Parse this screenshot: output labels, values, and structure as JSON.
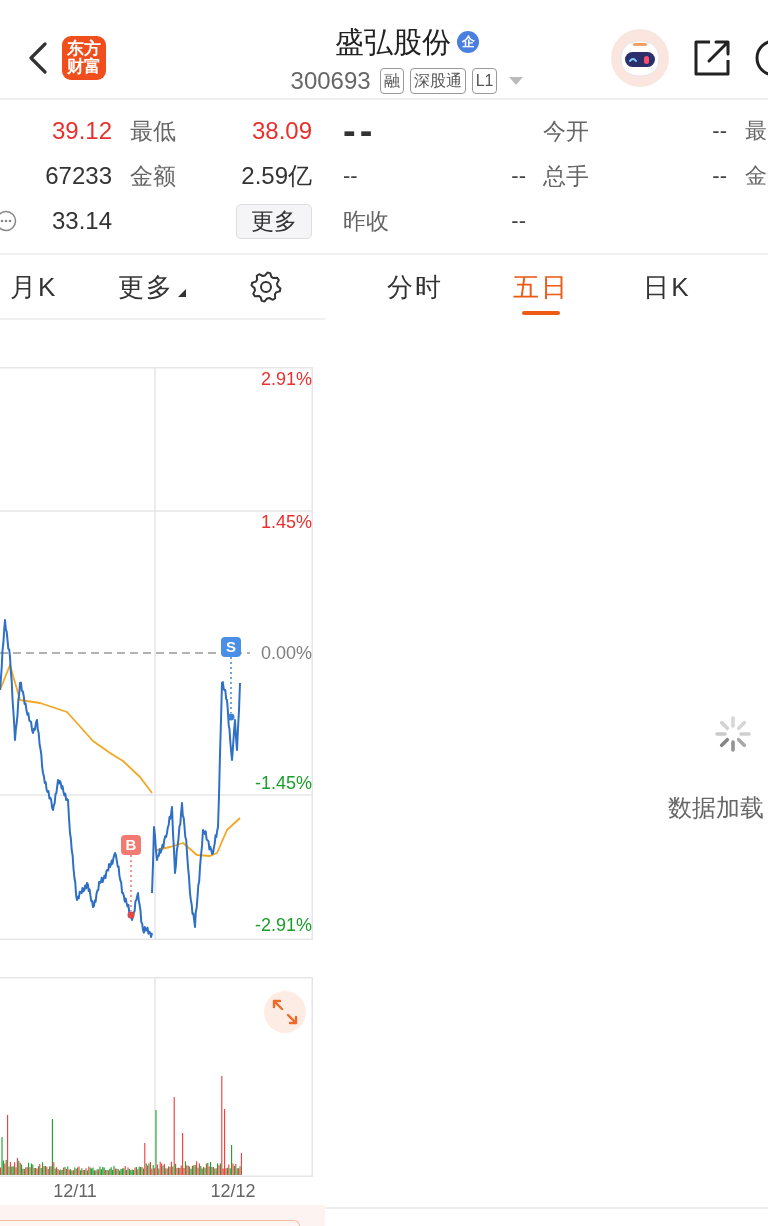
{
  "header": {
    "logo_text": "东方财富",
    "title": "盛弘股份",
    "title_badge": "企",
    "code": "300693",
    "tags": [
      "融",
      "深股通",
      "L1"
    ]
  },
  "left_quote": {
    "rows": [
      {
        "value": {
          "text": "39.12",
          "color": "#e8312f"
        },
        "label": "最低",
        "value2": {
          "text": "38.09",
          "color": "#e8312f"
        }
      },
      {
        "value": {
          "text": "67233",
          "color": "#333333"
        },
        "label": "金额",
        "value2": {
          "text": "2.59亿",
          "color": "#333333"
        }
      },
      {
        "value": {
          "text": "33.14",
          "color": "#333333"
        }
      }
    ],
    "more_button": "更多"
  },
  "left_tabs": [
    {
      "label": "月K",
      "selected": false,
      "kind": "tab"
    },
    {
      "label": "更多",
      "selected": false,
      "kind": "dropdown"
    }
  ],
  "price_chart": {
    "y_labels": [
      {
        "text": "2.91%",
        "color": "#e8312f"
      },
      {
        "text": "1.45%",
        "color": "#e8312f"
      },
      {
        "text": "0.00%",
        "color": "#808080"
      },
      {
        "text": "-1.45%",
        "color": "#1a9e2a"
      },
      {
        "text": "-2.91%",
        "color": "#1a9e2a"
      }
    ],
    "markers": [
      {
        "label": "B",
        "kind": "buy"
      },
      {
        "label": "S",
        "kind": "sell"
      }
    ]
  },
  "volume_chart": {
    "x_labels": [
      "12/11",
      "12/12"
    ]
  },
  "right_quote": {
    "price": "--",
    "change": "--",
    "change_pct": "--",
    "prev_close_label": "昨收",
    "prev_close": "--",
    "fields": [
      {
        "label": "今开",
        "value": "--",
        "next_label": "最"
      },
      {
        "label": "总手",
        "value": "--",
        "next_label": "金"
      }
    ]
  },
  "right_tabs": [
    {
      "label": "分时",
      "selected": false
    },
    {
      "label": "五日",
      "selected": true
    },
    {
      "label": "日K",
      "selected": false
    }
  ],
  "loading_text": "数据加载"
}
